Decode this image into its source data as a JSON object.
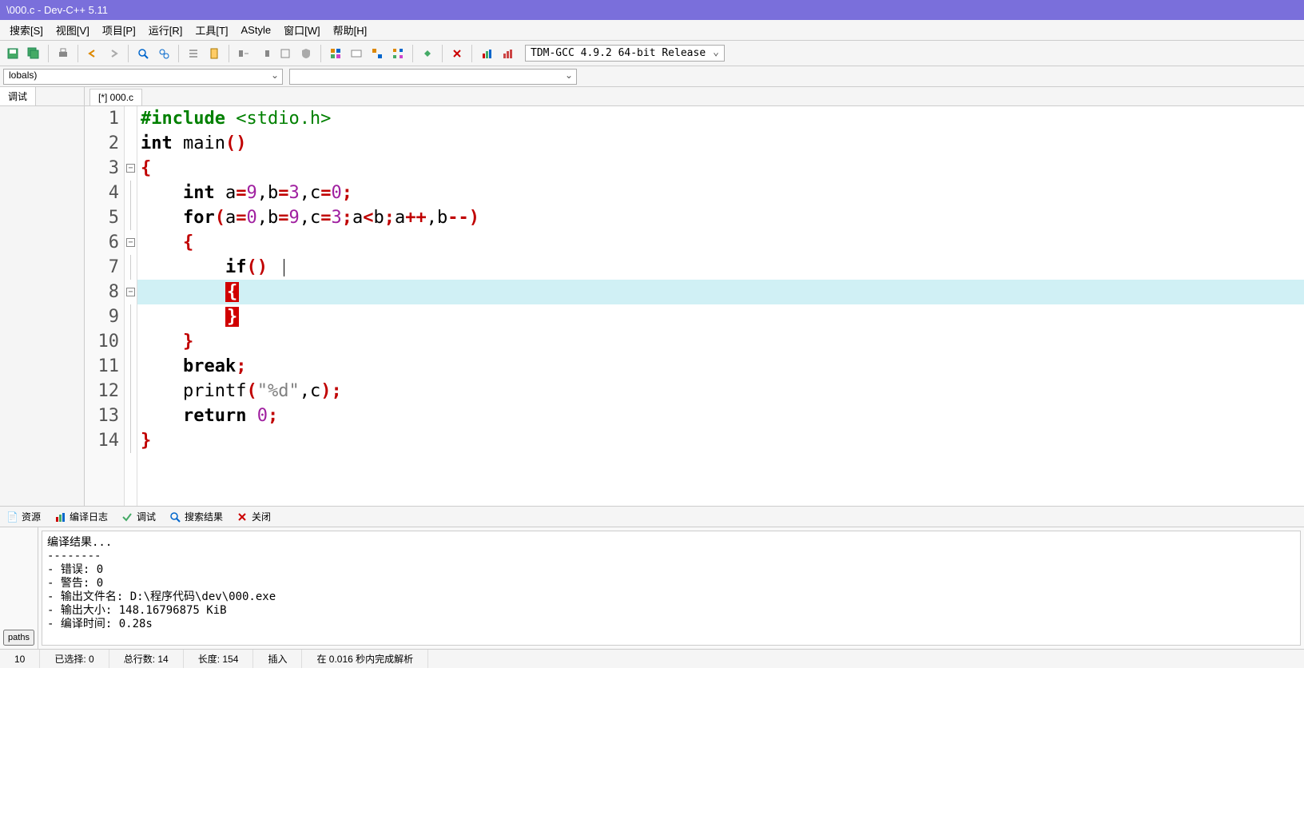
{
  "title": "\\000.c - Dev-C++ 5.11",
  "menu": {
    "search": "搜索[S]",
    "view": "视图[V]",
    "project": "项目[P]",
    "run": "运行[R]",
    "tools": "工具[T]",
    "astyle": "AStyle",
    "window": "窗口[W]",
    "help": "帮助[H]"
  },
  "compiler_select": "TDM-GCC 4.9.2 64-bit Release",
  "globals_dd": "lobals)",
  "left_tab_debug": "调试",
  "file_tab": "[*] 000.c",
  "code": {
    "l1_a": "#include ",
    "l1_b": "<stdio.h>",
    "l2_a": "int",
    "l2_b": " main",
    "l2_c": "()",
    "l3": "{",
    "l4_a": "int",
    "l4_b": " a",
    "l4_eq1": "=",
    "l4_n1": "9",
    "l4_c1": ",b",
    "l4_eq2": "=",
    "l4_n2": "3",
    "l4_c2": ",c",
    "l4_eq3": "=",
    "l4_n3": "0",
    "l4_sc": ";",
    "l5_a": "for",
    "l5_p1": "(",
    "l5_b": "a",
    "l5_eq1": "=",
    "l5_n1": "0",
    "l5_c1": ",b",
    "l5_eq2": "=",
    "l5_n2": "9",
    "l5_c2": ",c",
    "l5_eq3": "=",
    "l5_n3": "3",
    "l5_sc1": ";",
    "l5_d": "a",
    "l5_lt": "<",
    "l5_e": "b",
    "l5_sc2": ";",
    "l5_f": "a",
    "l5_pp": "++",
    "l5_c3": ",b",
    "l5_mm": "--",
    "l5_p2": ")",
    "l6": "{",
    "l7_a": "if",
    "l7_p": "()",
    "l8": "{",
    "l9": "}",
    "l10": "}",
    "l11_a": "break",
    "l11_sc": ";",
    "l12_a": "printf",
    "l12_p1": "(",
    "l12_s": "\"%d\"",
    "l12_c": ",c",
    "l12_p2": ")",
    "l12_sc": ";",
    "l13_a": "return",
    "l13_sp": " ",
    "l13_n": "0",
    "l13_sc": ";",
    "l14": "}"
  },
  "line_numbers": [
    "1",
    "2",
    "3",
    "4",
    "5",
    "6",
    "7",
    "8",
    "9",
    "10",
    "11",
    "12",
    "13",
    "14"
  ],
  "bottom_tabs": {
    "resource": "资源",
    "compile_log": "编译日志",
    "debug": "调试",
    "search_result": "搜索结果",
    "close": "关闭"
  },
  "left_paths": "paths",
  "compile_output": "编译结果...\n--------\n- 错误: 0\n- 警告: 0\n- 输出文件名: D:\\程序代码\\dev\\000.exe\n- 输出大小: 148.16796875 KiB\n- 编译时间: 0.28s",
  "status": {
    "line_col": "10",
    "selected": "已选择:   0",
    "total_lines": "总行数:   14",
    "length": "长度:   154",
    "mode": "插入",
    "parse": "在 0.016 秒内完成解析"
  }
}
